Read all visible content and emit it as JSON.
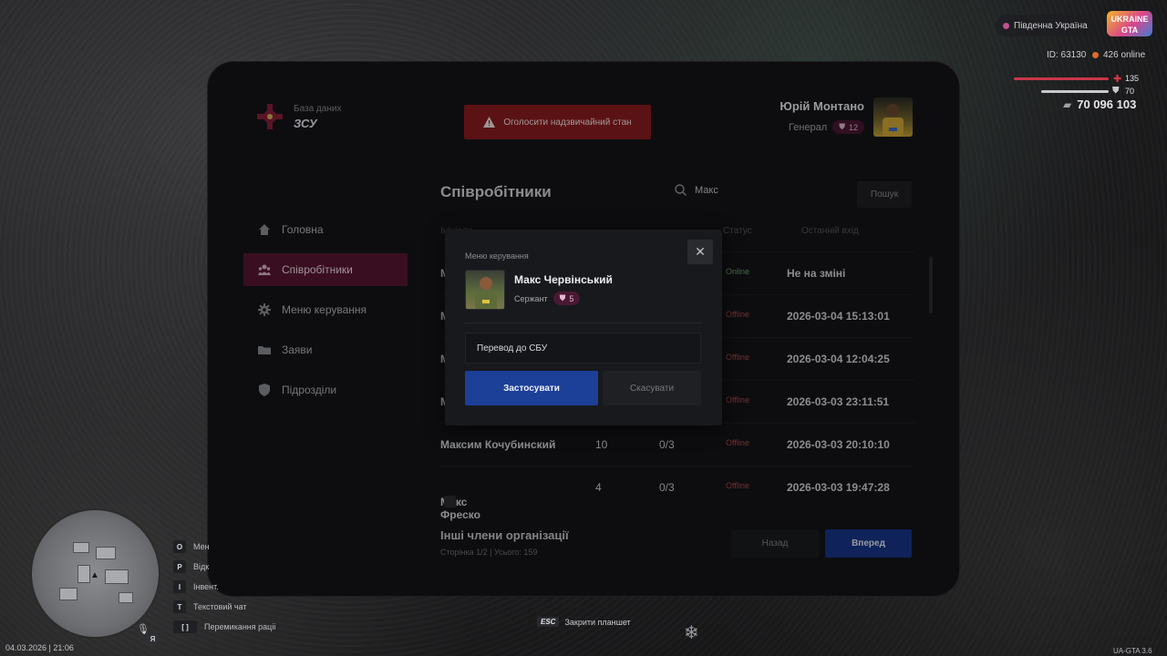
{
  "hud": {
    "server_name": "Південна Україна",
    "logo_text": "UKRAINE GTA",
    "player_id": "ID: 63130",
    "online": "426 online",
    "health": "135",
    "armor": "70",
    "money": "70 096 103",
    "datetime": "04.03.2026 | 21:06",
    "voice_key": "Я",
    "version": "UA-GTA 3.6",
    "esc_key": "ESC",
    "esc_label": "Закрити планшет",
    "hotkeys": [
      {
        "key": "O",
        "label": "Мен"
      },
      {
        "key": "P",
        "label": "Відк"
      },
      {
        "key": "I",
        "label": "Інвент."
      },
      {
        "key": "T",
        "label": "Текстовий чат"
      },
      {
        "key": "[ ]",
        "label": "Перемикання раціі"
      }
    ]
  },
  "tablet": {
    "brand_sub": "База даних",
    "brand_name": "ЗСУ",
    "emergency_label": "Оголосити надзвичайний стан",
    "user_name": "Юрій Монтано",
    "user_rank": "Генерал",
    "user_level": "12",
    "menu": [
      {
        "label": "Головна",
        "icon": "home-icon"
      },
      {
        "label": "Співробітники",
        "icon": "users-icon",
        "active": true
      },
      {
        "label": "Меню керування",
        "icon": "gear-icon"
      },
      {
        "label": "Заяви",
        "icon": "folder-icon"
      },
      {
        "label": "Підрозділи",
        "icon": "shield-icon"
      }
    ],
    "section_title": "Співробітники",
    "search_value": "Макс",
    "search_button": "Пошук",
    "columns": {
      "name": "Ініціали",
      "status": "Статус",
      "last_login": "Останній вхід"
    },
    "rows": [
      {
        "name": "М",
        "level": "",
        "tasks": "",
        "status": "Online",
        "last": "Не на зміні"
      },
      {
        "name": "М",
        "level": "",
        "tasks": "",
        "status": "Offline",
        "last": "2026-03-04 15:13:01"
      },
      {
        "name": "М",
        "level": "",
        "tasks": "",
        "status": "Offline",
        "last": "2026-03-04 12:04:25"
      },
      {
        "name": "М",
        "level": "",
        "tasks": "",
        "status": "Offline",
        "last": "2026-03-03 23:11:51"
      },
      {
        "name": "Максим Кочубинский",
        "level": "10",
        "tasks": "0/3",
        "status": "Offline",
        "last": "2026-03-03 20:10:10"
      },
      {
        "name": "Макс Фреско",
        "level": "4",
        "tasks": "0/3",
        "status": "Offline",
        "last": "2026-03-03 19:47:28"
      }
    ],
    "others_title": "Інші члени організації",
    "others_sub": "Сторінка 1/2 | Усього: 159",
    "back_label": "Назад",
    "forward_label": "Вперед"
  },
  "modal": {
    "title": "Меню керування",
    "close": "✕",
    "name": "Макс Червінський",
    "rank": "Сержант",
    "level": "5",
    "action": "Перевод до СБУ",
    "apply": "Застосувати",
    "cancel": "Скасувати"
  },
  "colors": {
    "accent": "#5a1633",
    "primary": "#1c3f98",
    "danger": "#8c1c1f",
    "online": "#6ea86f",
    "offline": "#b74848"
  }
}
